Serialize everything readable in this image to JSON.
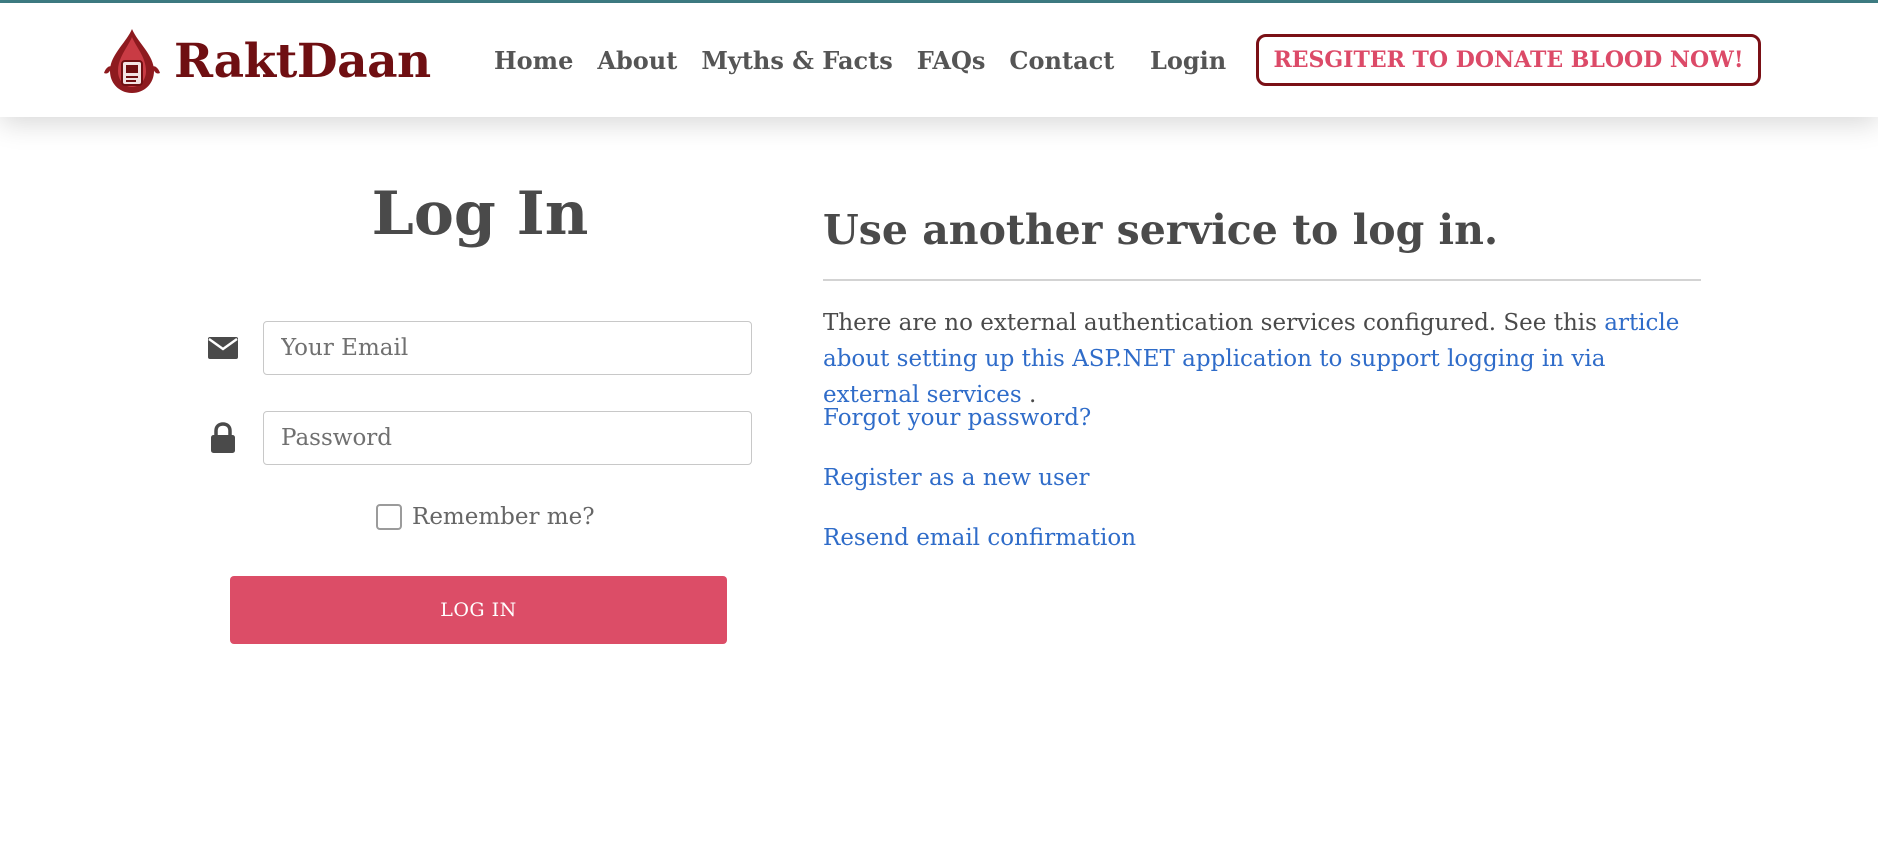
{
  "nav": {
    "brand": "RaktDaan",
    "links": [
      "Home",
      "About",
      "Myths & Facts",
      "FAQs",
      "Contact"
    ],
    "login": "Login",
    "cta": "RESGITER TO DONATE BLOOD NOW!"
  },
  "login_form": {
    "title": "Log In",
    "email_placeholder": "Your Email",
    "password_placeholder": "Password",
    "remember_label": "Remember me?",
    "submit_label": "LOG IN"
  },
  "external": {
    "title": "Use another service to log in.",
    "text": "There are no external authentication services configured. See this ",
    "link_text": "article about setting up this ASP.NET application to support logging in via external services",
    "text_end": " .",
    "forgot": "Forgot your password?",
    "register": "Register as a new user",
    "resend": "Resend email confirmation"
  },
  "icons": {
    "logo": "blood-drop-logo-icon",
    "email": "envelope-icon",
    "password": "lock-icon"
  },
  "colors": {
    "brand": "#6f0f12",
    "accent": "#dc4d67",
    "link": "#2f6cc9",
    "topline": "#3f7f86"
  }
}
